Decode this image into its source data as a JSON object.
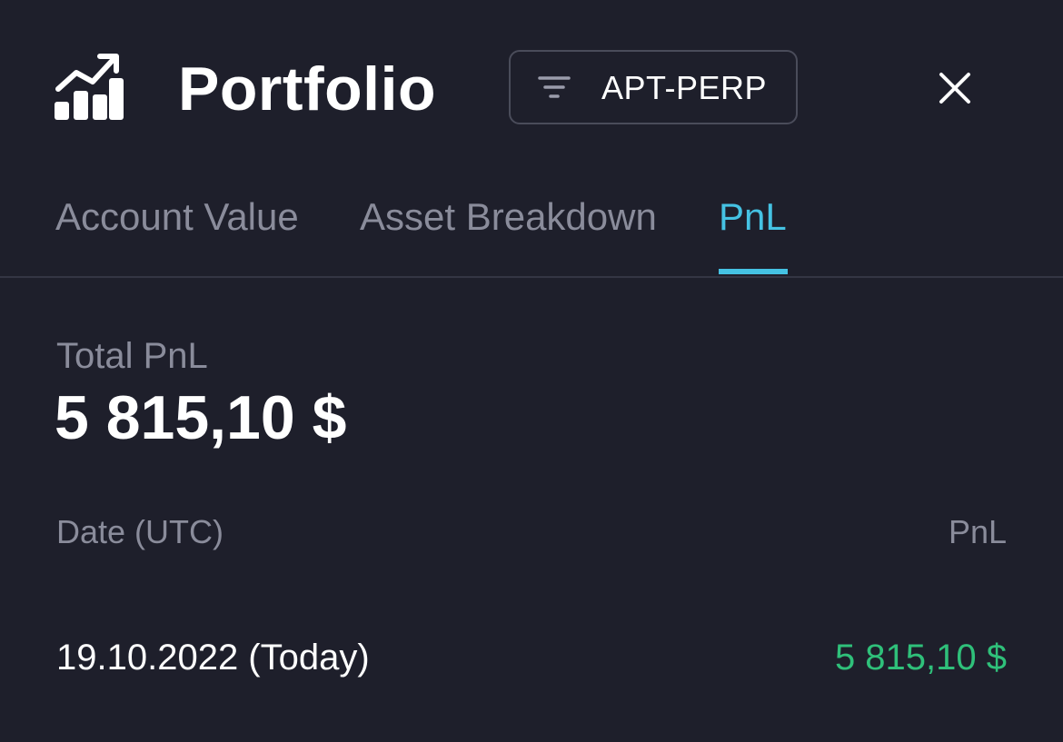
{
  "header": {
    "title": "Portfolio",
    "filter_label": "APT-PERP",
    "icons": {
      "logo": "chart-trending-up-icon",
      "filter": "filter-icon",
      "close": "close-icon"
    }
  },
  "tabs": [
    {
      "label": "Account Value",
      "active": false
    },
    {
      "label": "Asset Breakdown",
      "active": false
    },
    {
      "label": "PnL",
      "active": true
    }
  ],
  "summary": {
    "label": "Total PnL",
    "value": "5 815,10 $"
  },
  "table": {
    "columns": [
      "Date (UTC)",
      "PnL"
    ],
    "rows": [
      {
        "date": "19.10.2022 (Today)",
        "pnl": "5 815,10 $"
      }
    ]
  },
  "colors": {
    "background": "#1e1f2b",
    "accent": "#45c2e3",
    "positive": "#2fc07a",
    "muted_text": "#8a8c9b"
  }
}
